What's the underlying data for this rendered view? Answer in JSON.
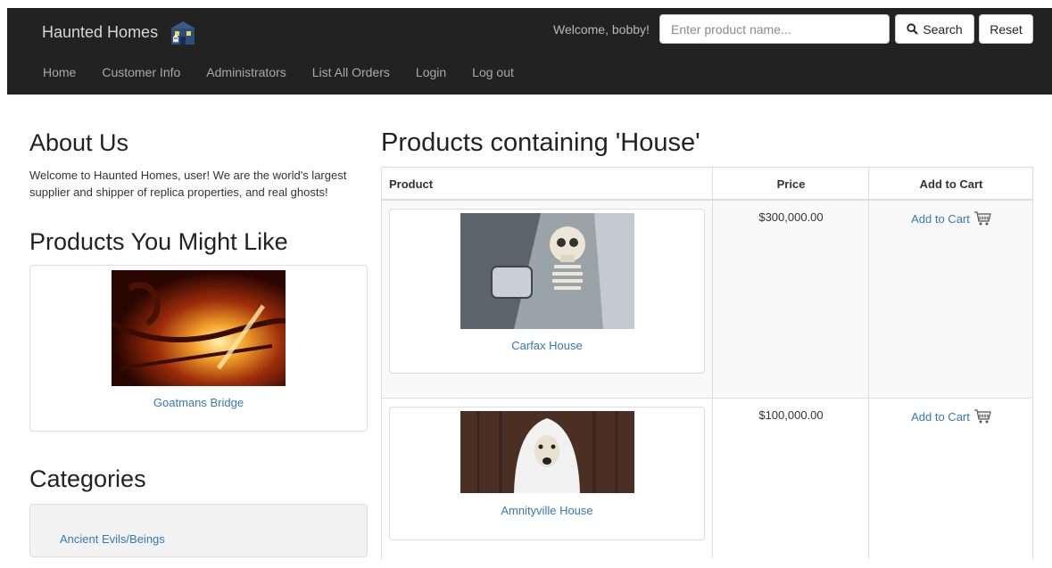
{
  "brand": {
    "title": "Haunted Homes"
  },
  "header": {
    "welcome": "Welcome, bobby!",
    "search_placeholder": "Enter product name...",
    "search_label": "Search",
    "reset_label": "Reset"
  },
  "nav": {
    "items": [
      "Home",
      "Customer Info",
      "Administrators",
      "List All Orders",
      "Login",
      "Log out"
    ]
  },
  "about": {
    "heading": "About Us",
    "text": "Welcome to Haunted Homes, user! We are the world's largest supplier and shipper of replica properties, and real ghosts!"
  },
  "recommended": {
    "heading": "Products You Might Like",
    "product_name": "Goatmans Bridge"
  },
  "categories": {
    "heading": "Categories",
    "items": [
      "Ancient Evils/Beings"
    ]
  },
  "products": {
    "heading": "Products containing 'House'",
    "columns": [
      "Product",
      "Price",
      "Add to Cart"
    ],
    "rows": [
      {
        "name": "Carfax House",
        "price": "$300,000.00",
        "action": "Add to Cart"
      },
      {
        "name": "Amnityville House",
        "price": "$100,000.00",
        "action": "Add to Cart"
      }
    ]
  },
  "colors": {
    "navbar": "#222222",
    "link": "#337ab7",
    "stripe": "#f9f9f9"
  },
  "icons": [
    "haunted-house-logo-icon",
    "search-icon",
    "shopping-cart-icon"
  ]
}
